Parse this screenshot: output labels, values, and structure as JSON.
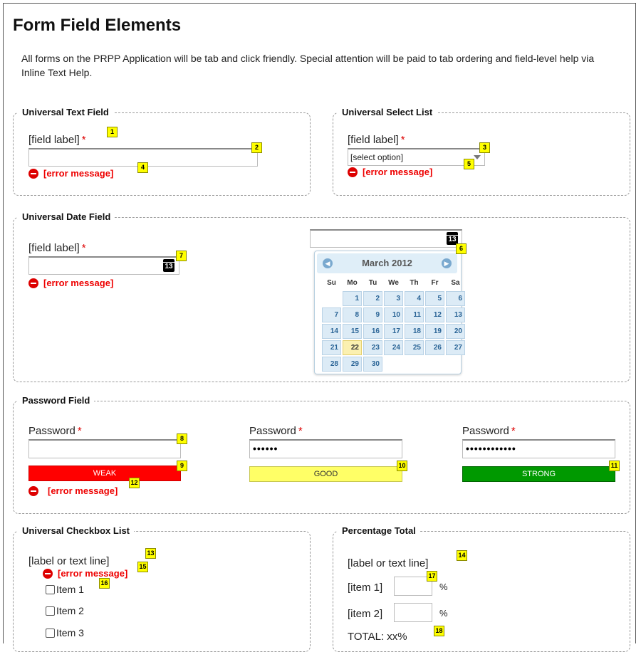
{
  "page": {
    "title": "Form Field Elements",
    "intro": "All forms on the PRPP Application will be tab and click friendly. Special attention will be paid to tab ordering and field-level help via Inline Text Help."
  },
  "common": {
    "field_label": "[field label]",
    "required_mark": "*",
    "error_message": "[error message]"
  },
  "text_field": {
    "legend": "Universal Text Field"
  },
  "select_list": {
    "legend": "Universal Select List",
    "selected": "[select option]"
  },
  "date_field": {
    "legend": "Universal Date Field",
    "calendar_icon_text": "13",
    "datepicker": {
      "month": "March 2012",
      "prev": "◀",
      "next": "▶",
      "weekdays": [
        "Su",
        "Mo",
        "Tu",
        "We",
        "Th",
        "Fr",
        "Sa"
      ],
      "leading_blanks": 1,
      "days": [
        "1",
        "2",
        "3",
        "4",
        "5",
        "6",
        "7",
        "8",
        "9",
        "10",
        "11",
        "12",
        "13",
        "14",
        "15",
        "16",
        "17",
        "18",
        "19",
        "20",
        "21",
        "22",
        "23",
        "24",
        "25",
        "26",
        "27",
        "28",
        "29",
        "30"
      ],
      "today": "22"
    }
  },
  "password": {
    "legend": "Password Field",
    "label": "Password",
    "fields": [
      {
        "value": "",
        "strength": "WEAK",
        "color": "#ff0000",
        "text_color": "#ffffff"
      },
      {
        "value": "••••••",
        "strength": "GOOD",
        "color": "#ffff66",
        "text_color": "#333333"
      },
      {
        "value": "••••••••••••",
        "strength": "STRONG",
        "color": "#009900",
        "text_color": "#ffffff"
      }
    ]
  },
  "checkbox_list": {
    "legend": "Universal Checkbox List",
    "label": "[label or text line]",
    "items": [
      "Item 1",
      "Item 2",
      "Item 3"
    ]
  },
  "percentage": {
    "legend": "Percentage Total",
    "label": "[label or text line]",
    "items": [
      "[item 1]",
      "[item 2]"
    ],
    "unit": "%",
    "total_label": "TOTAL:",
    "total_value": "xx%"
  },
  "badges": [
    "1",
    "2",
    "3",
    "4",
    "5",
    "6",
    "7",
    "8",
    "9",
    "10",
    "11",
    "12",
    "13",
    "14",
    "15",
    "16",
    "17",
    "18"
  ]
}
